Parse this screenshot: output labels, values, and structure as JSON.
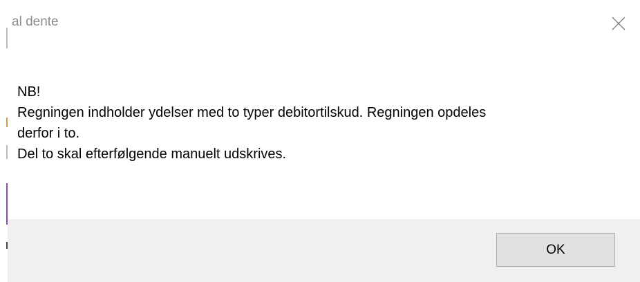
{
  "window": {
    "title": "al dente",
    "close_icon": "close-icon"
  },
  "message": {
    "lines": [
      "NB!",
      "Regningen indholder ydelser med to typer debitortilskud. Regningen opdeles",
      "derfor i to.",
      "Del to skal efterfølgende manuelt udskrives."
    ]
  },
  "footer": {
    "ok_label": "OK"
  },
  "colors": {
    "title_text": "#8c8c8c",
    "footer_bg": "#f0f0f0",
    "button_bg": "#e1e1e1",
    "button_border": "#adadad"
  }
}
